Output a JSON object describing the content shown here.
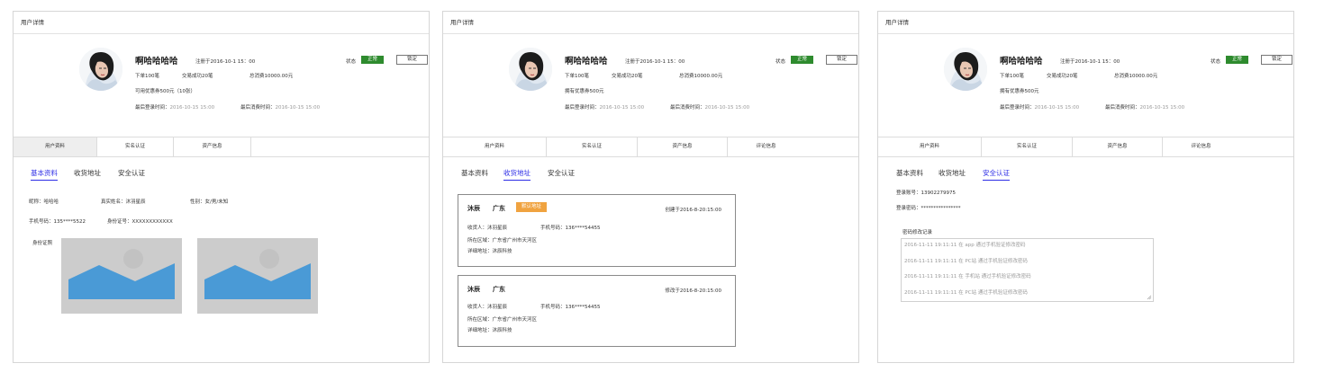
{
  "panels": [
    {
      "title": "用户详情",
      "user": {
        "name": "啊哈哈哈哈",
        "registered": "注册于2016-10-1 15：00",
        "orders": "下单100笔",
        "success": "交易成功20笔",
        "total": "总消费10000.00元",
        "coupon": "可用优惠券500元（10张）",
        "last_login_label": "最后登录时间：",
        "last_login": "2016-10-15 15:00",
        "last_spend_label": "最后消费时间：",
        "last_spend": "2016-10-15 15:00"
      },
      "status": {
        "label": "状态",
        "value": "正常",
        "lock": "锁定"
      },
      "tabs": [
        "用户资料",
        "实名认证",
        "资产信息"
      ],
      "subtabs": [
        "基本资料",
        "收货地址",
        "安全认证"
      ],
      "basic": {
        "nickname": "昵称：哈哈哈",
        "realname": "真实姓名：沐羽星辰",
        "gender": "性别：女/男/未知",
        "phone": "手机号码：135****5522",
        "idcard": "身份证号：XXXXXXXXXXXX",
        "idphoto": "身份证照"
      }
    },
    {
      "title": "用户详情",
      "user": {
        "name": "啊哈哈哈哈",
        "registered": "注册于2016-10-1 15：00",
        "orders": "下单100笔",
        "success": "交易成功20笔",
        "total": "总消费10000.00元",
        "coupon": "拥有优惠券500元",
        "last_login_label": "最后登录时间：",
        "last_login": "2016-10-15 15:00",
        "last_spend_label": "最后消费时间：",
        "last_spend": "2016-10-15 15:00"
      },
      "status": {
        "label": "状态",
        "value": "正常",
        "lock": "锁定"
      },
      "tabs": [
        "用户资料",
        "实名认证",
        "资产信息",
        "评论信息"
      ],
      "subtabs": [
        "基本资料",
        "收货地址",
        "安全认证"
      ],
      "addresses": [
        {
          "name": "沐辰",
          "province": "广东",
          "badge": "默认地址",
          "time": "创建于2016-8-20:15:00",
          "recipient": "收货人：沐羽星辰",
          "phone": "手机号码：136****54455",
          "region": "所在区域：广东省广州市天河区",
          "detail": "详细地址：沐辰科技"
        },
        {
          "name": "沐辰",
          "province": "广东",
          "badge": "",
          "time": "修改于2016-8-20:15:00",
          "recipient": "收货人：沐羽星辰",
          "phone": "手机号码：136****54455",
          "region": "所在区域：广东省广州市天河区",
          "detail": "详细地址：沐辰科技"
        }
      ]
    },
    {
      "title": "用户详情",
      "user": {
        "name": "啊哈哈哈哈",
        "registered": "注册于2016-10-1 15：00",
        "orders": "下单100笔",
        "success": "交易成功20笔",
        "total": "总消费10000.00元",
        "coupon": "拥有优惠券500元",
        "last_login_label": "最后登录时间：",
        "last_login": "2016-10-15 15:00",
        "last_spend_label": "最后消费时间：",
        "last_spend": "2016-10-15 15:00"
      },
      "status": {
        "label": "状态",
        "value": "正常",
        "lock": "锁定"
      },
      "tabs": [
        "用户资料",
        "实名认证",
        "资产信息",
        "评论信息"
      ],
      "subtabs": [
        "基本资料",
        "收货地址",
        "安全认证"
      ],
      "security": {
        "account": "登录账号：13902279975",
        "password": "登录密码：****************",
        "log_title": "密码修改记录",
        "logs": [
          "2016-11-11 19:11:11 在 app 通过手机验证修改密码",
          "2016-11-11 19:11:11 在 PC站 通过手机验证修改密码",
          "2016-11-11 19:11:11 在 手机站 通过手机验证修改密码",
          "2016-11-11 19:11:11 在 PC站 通过手机验证修改密码"
        ]
      }
    }
  ],
  "colors": {
    "active_blue": "#2d2de6",
    "status_green": "#2e8b2e",
    "badge_orange": "#f0a340",
    "placeholder_blue": "#4a9ad6"
  }
}
